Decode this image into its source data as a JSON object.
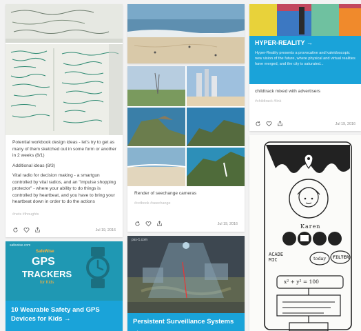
{
  "cards": {
    "workbook": {
      "description": "Potential workbook design ideas - let's try to get as many of them sketched out in some form or another in 2 weeks (8/1)",
      "additional": "Additional ideas (8/3)",
      "body": "Vital radio for decision making - a smartgun controlled by vital radios, and an \"impulse shopping protector\" - where your ability to do things is controlled by heartbeat, and you have to bring your heartbeat down in order to do the actions",
      "tags": "#nets #thoughts",
      "date": "Jul 19, 2016"
    },
    "seechange": {
      "caption": "Render of seechange cameras",
      "tags": "#cctbook #seechange",
      "date": "Jul 19, 2016"
    },
    "hyperreality": {
      "title": "HYPER-REALITY →",
      "description": "Hyper-Reality presents a provocative and kaleidoscopic new vision of the future, where physical and virtual realities have merged, and the city is saturated...",
      "caption": "childtrack mixed with advertisers",
      "tags": "#childtrack #link",
      "date": "Jul 19, 2016"
    },
    "gps": {
      "site": "safewise.com",
      "brand": "SafeWise",
      "heading_line1": "GPS",
      "heading_line2": "TRACKERS",
      "heading_line3": "for Kids",
      "title": "10 Wearable Safety and GPS Devices for Kids →"
    },
    "surveillance": {
      "site": "pss-1.com",
      "title": "Persistent Surveillance Systems →"
    },
    "sketch": {
      "name": "Karen",
      "label_academic": "ACADE MIC",
      "label_today": "today",
      "label_filter": "FILTER",
      "formula": "x² + y² = 100"
    }
  },
  "colors": {
    "accent": "#1aa3d9",
    "teal": "#1b8fa6",
    "tag": "#b8b8b8"
  }
}
